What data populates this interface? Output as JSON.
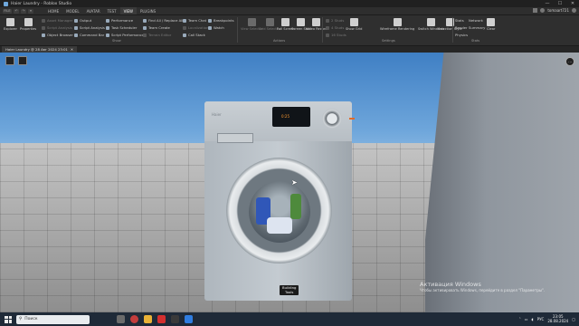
{
  "window": {
    "title": "Haier Laundry - Roblox Studio",
    "controls": [
      "—",
      "☐",
      "✕"
    ]
  },
  "menu": {
    "file": "FILE",
    "tabs": [
      "HOME",
      "MODEL",
      "AVATAR",
      "TEST",
      "VIEW",
      "PLUGINS"
    ],
    "active_tab": "VIEW",
    "user": "tomaart721"
  },
  "ribbon": {
    "explorer": "Explorer",
    "properties": "Properties",
    "show_col1": [
      "Asset Manager",
      "Script Analysis",
      "Object Browser"
    ],
    "show_col2": [
      "Output",
      "Script Analysis",
      "Command Bar"
    ],
    "show_col3": [
      "Performance",
      "Task Scheduler",
      "Script Performance"
    ],
    "show_col4": [
      "Find All / Replace All",
      "Team Create",
      "Terrain Editor"
    ],
    "show_col5": [
      "Team Chat",
      "Localization",
      "Call Stack"
    ],
    "show_col6": [
      "Breakpoints",
      "Watch"
    ],
    "show_label": "Show",
    "actions": [
      "View Selector",
      "Grid Selection",
      "Full Screen",
      "Screen Shot",
      "Video Record"
    ],
    "actions_label": "Actions",
    "settings_small": [
      "2 Studs",
      "4 Studs",
      "16 Studs"
    ],
    "settings": [
      "Show Grid",
      "Wireframe Rendering",
      "Switch Windows",
      "Selection Style"
    ],
    "settings_label": "Settings",
    "stats_small": [
      "Stats",
      "Render",
      "Physics"
    ],
    "stats_small2": [
      "Network",
      "Summary"
    ],
    "clear": "Clear",
    "stats_label": "Stats"
  },
  "document_tab": {
    "label": "Haier Laundry @ 28 Авг 2024 23:01"
  },
  "viewport": {
    "washer_brand": "Haier",
    "display_text": "0:25",
    "tooltip": [
      "Building",
      "Tools"
    ],
    "activation_title": "Активация Windows",
    "activation_text": "Чтобы активировать Windows, перейдите в раздел \"Параметры\"."
  },
  "taskbar": {
    "search_placeholder": "Поиск",
    "app_colors": [
      "#6b6b6b",
      "#c33c3c",
      "#e9b237",
      "#d32f2f",
      "#3a3a3a",
      "#2f7de1"
    ],
    "language": "РУС",
    "time": "23:05",
    "date": "28.08.2024"
  }
}
